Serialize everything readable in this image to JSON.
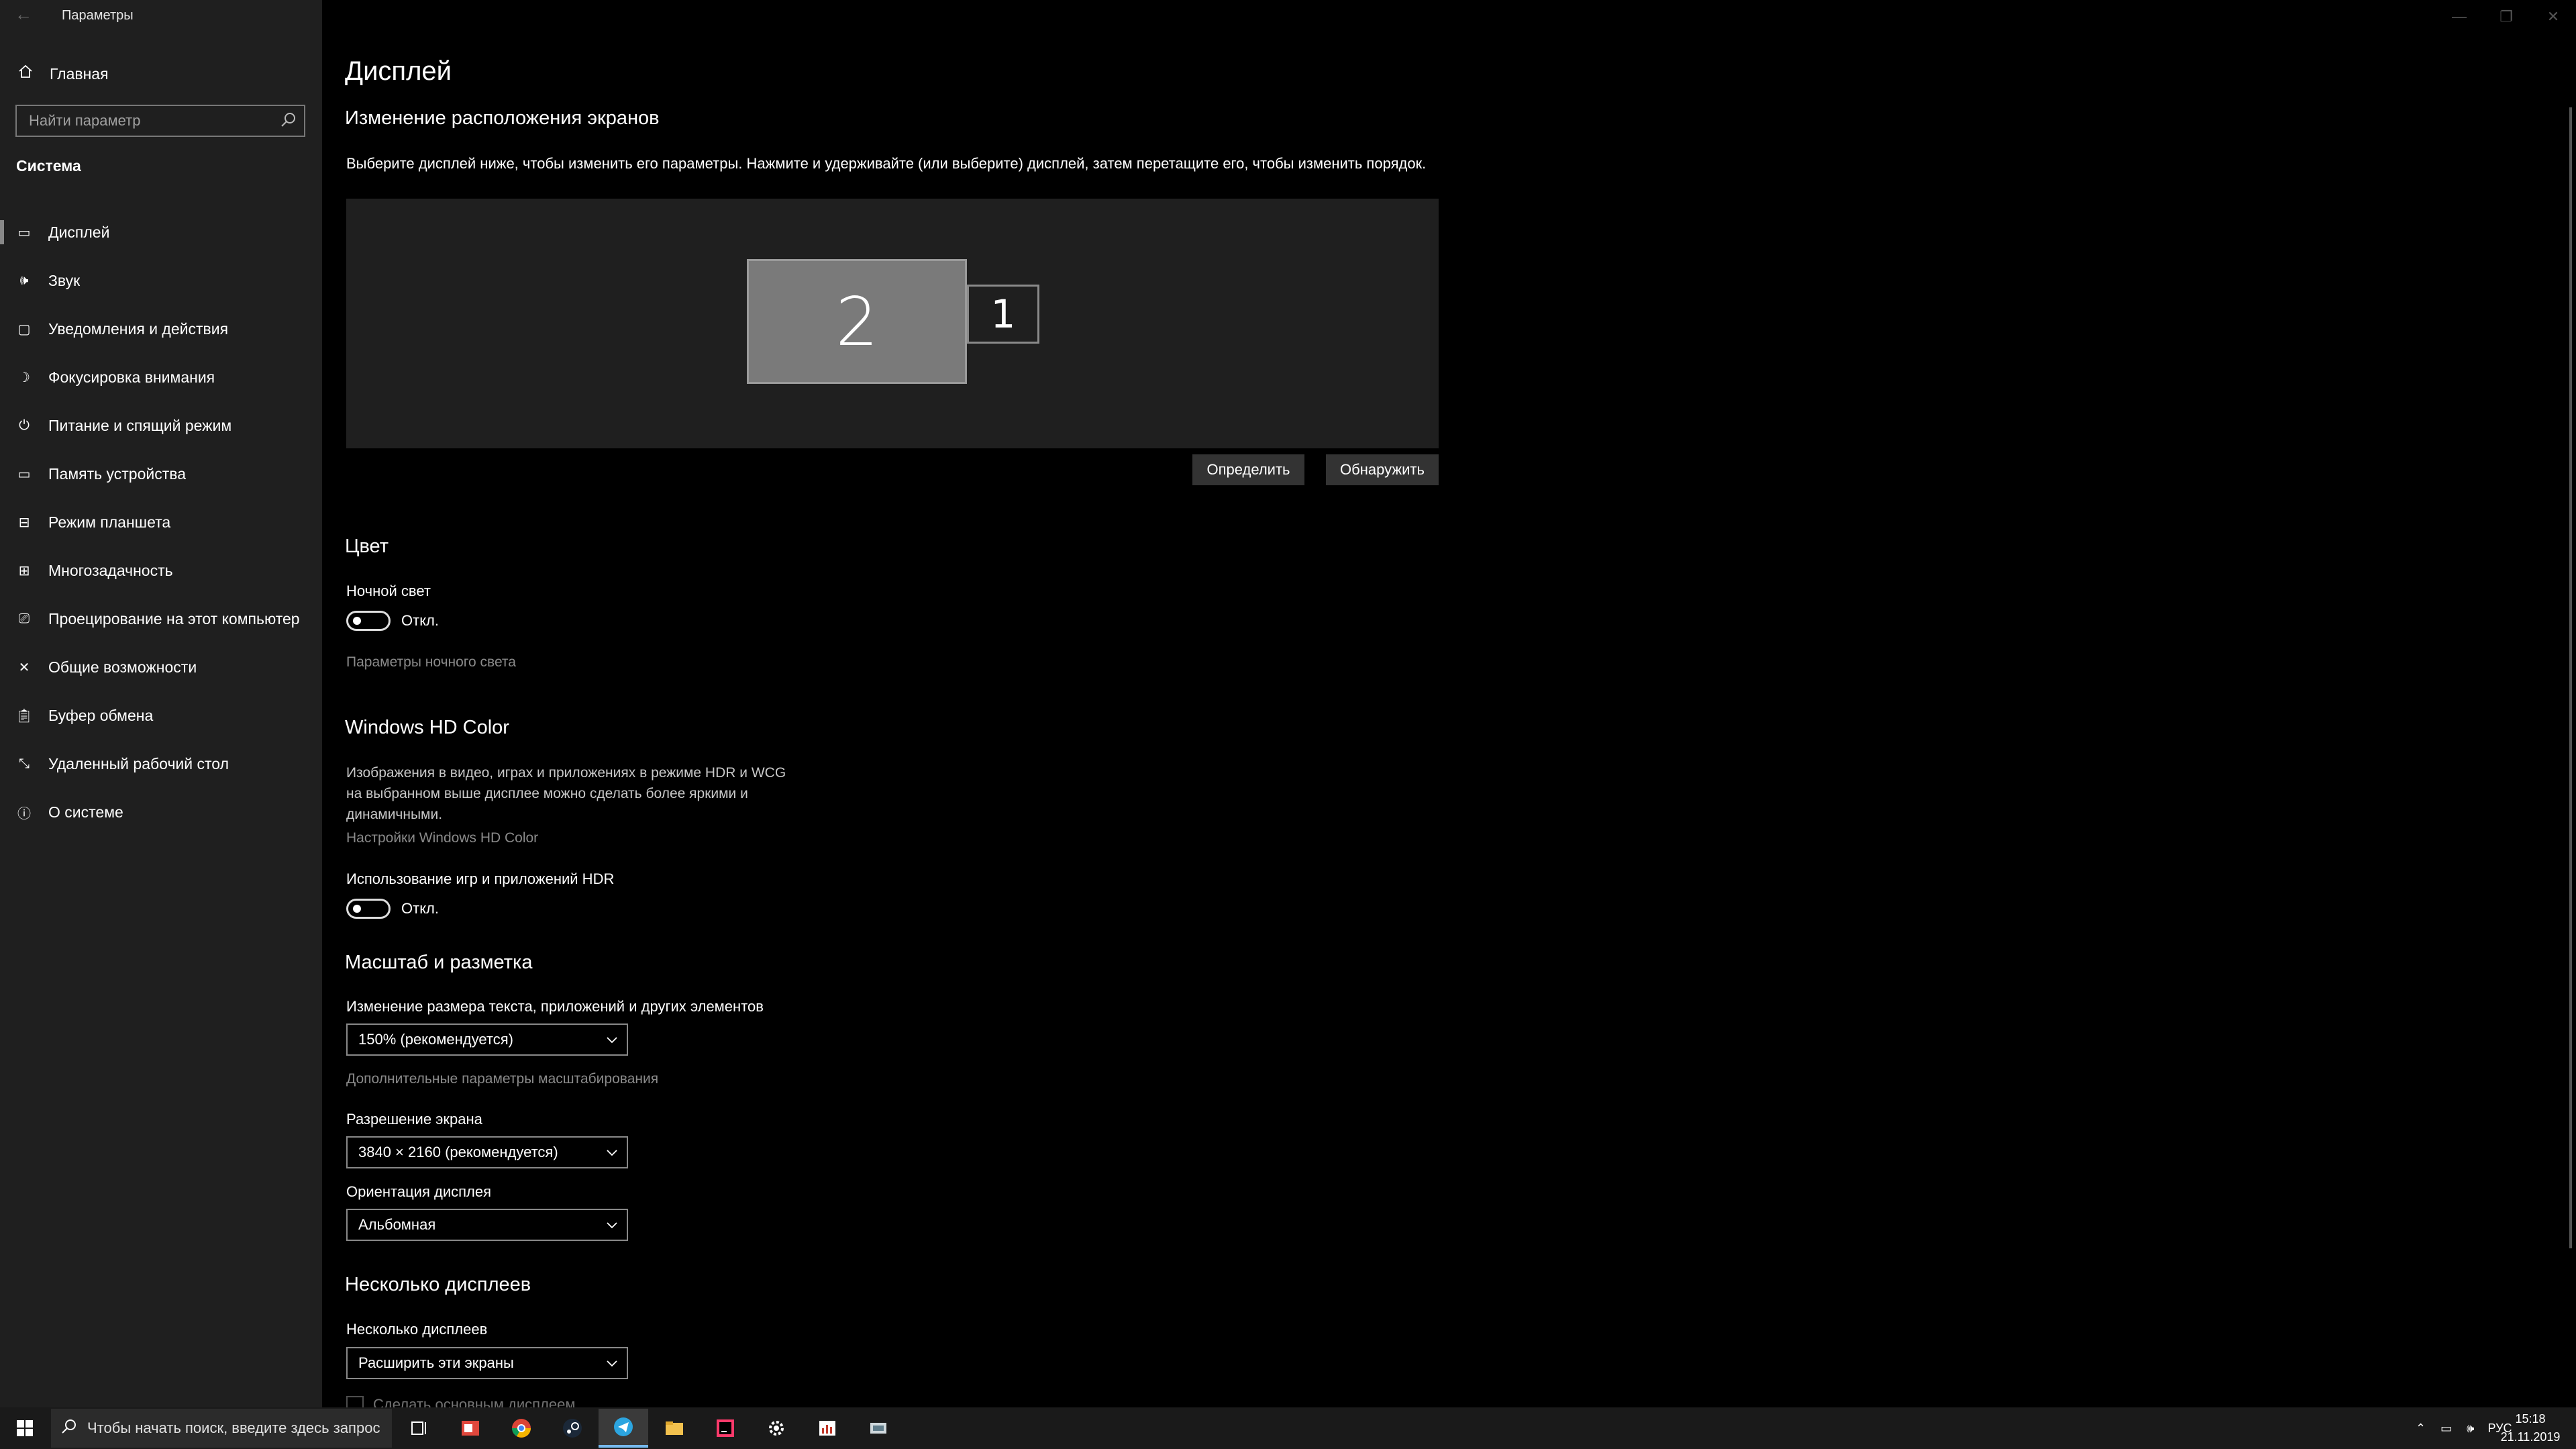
{
  "window": {
    "title": "Параметры",
    "back_icon": "back-arrow-icon",
    "minimize_icon": "minimize-icon",
    "maximize_icon": "restore-icon",
    "close_icon": "close-icon"
  },
  "sidebar": {
    "home_label": "Главная",
    "search_placeholder": "Найти параметр",
    "group_title": "Система",
    "items": [
      {
        "label": "Дисплей",
        "icon": "monitor-icon",
        "active": true
      },
      {
        "label": "Звук",
        "icon": "speaker-icon"
      },
      {
        "label": "Уведомления и действия",
        "icon": "notification-icon"
      },
      {
        "label": "Фокусировка внимания",
        "icon": "moon-icon"
      },
      {
        "label": "Питание и спящий режим",
        "icon": "power-icon"
      },
      {
        "label": "Память устройства",
        "icon": "storage-icon"
      },
      {
        "label": "Режим планшета",
        "icon": "tablet-icon"
      },
      {
        "label": "Многозадачность",
        "icon": "multitask-icon"
      },
      {
        "label": "Проецирование на этот компьютер",
        "icon": "project-icon"
      },
      {
        "label": "Общие возможности",
        "icon": "shared-icon"
      },
      {
        "label": "Буфер обмена",
        "icon": "clipboard-icon"
      },
      {
        "label": "Удаленный рабочий стол",
        "icon": "remote-desktop-icon"
      },
      {
        "label": "О системе",
        "icon": "info-icon"
      }
    ]
  },
  "main": {
    "title": "Дисплей",
    "arrange": {
      "heading": "Изменение расположения экранов",
      "description": "Выберите дисплей ниже, чтобы изменить его параметры. Нажмите и удерживайте (или выберите) дисплей, затем перетащите его, чтобы изменить порядок.",
      "monitor_selected": "2",
      "monitor_other": "1",
      "identify_label": "Определить",
      "detect_label": "Обнаружить"
    },
    "color": {
      "heading": "Цвет",
      "night_light_label": "Ночной свет",
      "night_light_state": "Откл.",
      "night_light_link": "Параметры ночного света"
    },
    "hdr": {
      "heading": "Windows HD Color",
      "description": "Изображения в видео, играх и приложениях в режиме HDR и WCG на выбранном выше дисплее можно сделать более яркими и динамичными.",
      "link": "Настройки Windows HD Color",
      "toggle_label": "Использование игр и приложений HDR",
      "toggle_state": "Откл."
    },
    "scale": {
      "heading": "Масштаб и разметка",
      "scale_label": "Изменение размера текста, приложений и других элементов",
      "scale_value": "150% (рекомендуется)",
      "advanced_link": "Дополнительные параметры масштабирования",
      "resolution_label": "Разрешение экрана",
      "resolution_value": "3840 × 2160 (рекомендуется)",
      "orientation_label": "Ориентация дисплея",
      "orientation_value": "Альбомная"
    },
    "multi": {
      "heading": "Несколько дисплеев",
      "label": "Несколько дисплеев",
      "value": "Расширить эти экраны",
      "checkbox_label": "Сделать основным дисплеем"
    }
  },
  "taskbar": {
    "search_placeholder": "Чтобы начать поиск, введите здесь запрос",
    "apps": [
      "task-view-icon",
      "mail-icon",
      "chrome-icon",
      "steam-icon",
      "telegram-icon",
      "file-explorer-icon",
      "intellij-icon",
      "settings-icon",
      "monitor-app-icon",
      "remote-app-icon"
    ],
    "language": "РУС",
    "time": "15:18",
    "date": "21.11.2019"
  },
  "colors": {
    "sidebar_bg": "#1f1f1f",
    "main_bg": "#000000",
    "taskbar_bg": "#1a1a1a",
    "accent": "#76b9ed"
  }
}
